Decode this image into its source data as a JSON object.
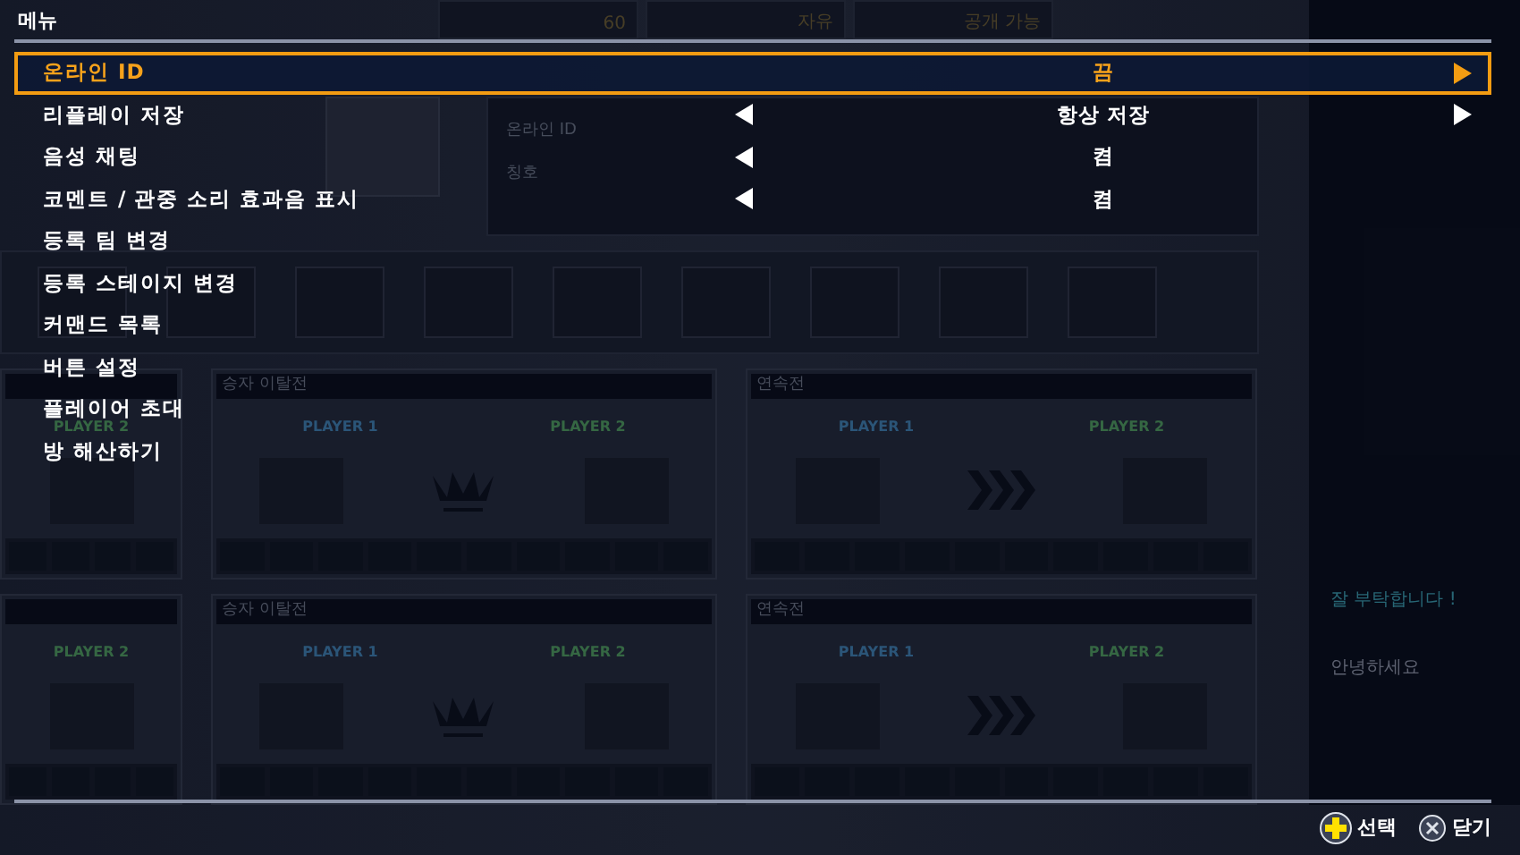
{
  "background": {
    "stats": [
      "60",
      "자유",
      "공개 가능"
    ],
    "profile_labels": [
      "온라인 ID",
      "칭호"
    ],
    "card_rows": [
      [
        {
          "kind": "partial",
          "players": [
            "PLAYER 2"
          ]
        },
        {
          "kind": "crown",
          "title": "승자 이탈전",
          "players": [
            "PLAYER 1",
            "PLAYER 2"
          ]
        },
        {
          "kind": "chevrons",
          "title": "연속전",
          "players": [
            "PLAYER 1",
            "PLAYER 2"
          ]
        }
      ],
      [
        {
          "kind": "partial",
          "players": [
            "PLAYER 2"
          ]
        },
        {
          "kind": "crown",
          "title": "승자 이탈전",
          "players": [
            "PLAYER 1",
            "PLAYER 2"
          ]
        },
        {
          "kind": "chevrons",
          "title": "연속전",
          "players": [
            "PLAYER 1",
            "PLAYER 2"
          ]
        }
      ]
    ],
    "chat": [
      {
        "message": "잘 부탁합니다 !",
        "kind": "highlight"
      },
      {
        "message": "안녕하세요",
        "kind": "normal"
      }
    ]
  },
  "menu": {
    "title": "메뉴",
    "items": [
      {
        "label": "온라인 ID",
        "kind": "option",
        "value": "끔",
        "has_prev": false,
        "has_next": true,
        "selected": true
      },
      {
        "label": "리플레이 저장",
        "kind": "option",
        "value": "항상 저장",
        "has_prev": true,
        "has_next": true,
        "selected": false
      },
      {
        "label": "음성 채팅",
        "kind": "option",
        "value": "켬",
        "has_prev": true,
        "has_next": false,
        "selected": false
      },
      {
        "label": "코멘트 / 관중 소리 효과음 표시",
        "kind": "option",
        "value": "켬",
        "has_prev": true,
        "has_next": false,
        "selected": false
      },
      {
        "label": "등록 팀 변경",
        "kind": "action",
        "selected": false
      },
      {
        "label": "등록 스테이지 변경",
        "kind": "action",
        "selected": false
      },
      {
        "label": "커맨드 목록",
        "kind": "action",
        "selected": false
      },
      {
        "label": "버튼 설정",
        "kind": "action",
        "selected": false
      },
      {
        "label": "플레이어 초대",
        "kind": "action",
        "selected": false
      },
      {
        "label": "방 해산하기",
        "kind": "action",
        "selected": false
      }
    ]
  },
  "footer": [
    {
      "kind": "dpad",
      "label": "선택"
    },
    {
      "kind": "cross",
      "label": "닫기"
    }
  ]
}
